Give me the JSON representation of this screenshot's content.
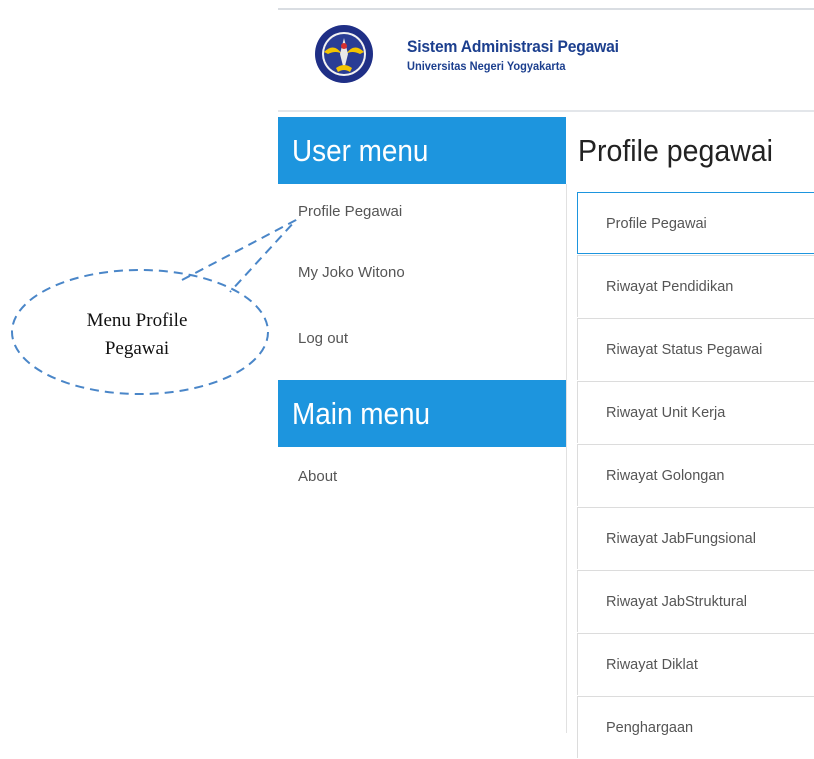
{
  "header": {
    "app_title": "Sistem Administrasi Pegawai",
    "app_subtitle": "Universitas Negeri Yogyakarta",
    "logo_icon": "university-seal-icon"
  },
  "sidebar": {
    "user_menu_title": "User menu",
    "user_menu_items": [
      "Profile Pegawai",
      "My Joko Witono",
      "Log out"
    ],
    "main_menu_title": "Main menu",
    "main_menu_items": [
      "About"
    ]
  },
  "main": {
    "page_title": "Profile pegawai",
    "tabs": [
      "Profile Pegawai",
      "Riwayat Pendidikan",
      "Riwayat Status Pegawai",
      "Riwayat Unit Kerja",
      "Riwayat Golongan",
      "Riwayat JabFungsional",
      "Riwayat JabStruktural",
      "Riwayat Diklat",
      "Penghargaan"
    ],
    "active_tab": "Profile Pegawai"
  },
  "callout": {
    "line1": "Menu Profile",
    "line2": "Pegawai"
  },
  "colors": {
    "accent": "#1d95de",
    "brand_text": "#1c3f8e",
    "callout_stroke": "#4a86c8"
  }
}
